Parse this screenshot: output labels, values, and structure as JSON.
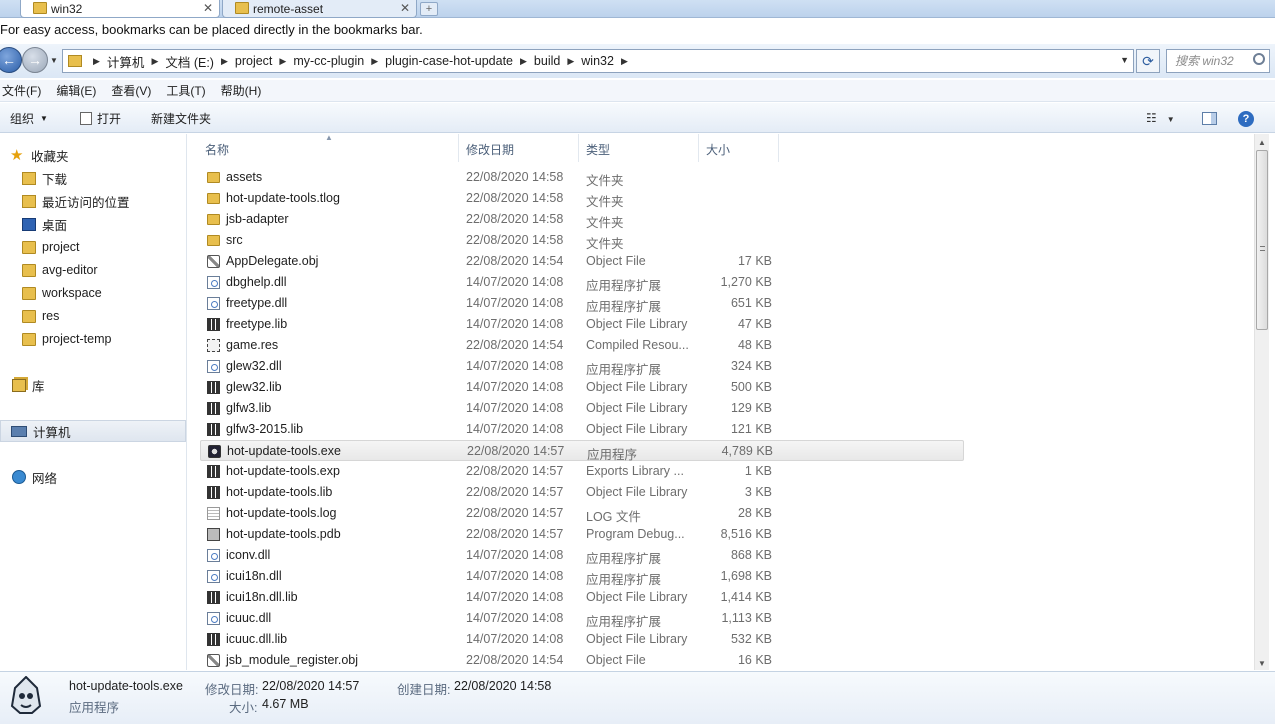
{
  "tabs": [
    {
      "label": "win32",
      "active": true
    },
    {
      "label": "remote-asset",
      "active": false
    }
  ],
  "bookmark_hint": "For easy access, bookmarks can be placed directly in the bookmarks bar.",
  "address": {
    "crumbs": [
      "计算机",
      "文档 (E:)",
      "project",
      "my-cc-plugin",
      "plugin-case-hot-update",
      "build",
      "win32"
    ],
    "search_placeholder": "搜索 win32"
  },
  "menu": [
    "文件(F)",
    "编辑(E)",
    "查看(V)",
    "工具(T)",
    "帮助(H)"
  ],
  "toolbar": {
    "organize": "组织",
    "open": "打开",
    "new_folder": "新建文件夹"
  },
  "nav": {
    "favorites": "收藏夹",
    "favorites_items": [
      "下载",
      "最近访问的位置",
      "桌面",
      "project",
      "avg-editor",
      "workspace",
      "res",
      "project-temp"
    ],
    "libraries": "库",
    "computer": "计算机",
    "network": "网络"
  },
  "columns": {
    "name": "名称",
    "date": "修改日期",
    "type": "类型",
    "size": "大小"
  },
  "files": [
    {
      "name": "assets",
      "date": "22/08/2020 14:58",
      "type": "文件夹",
      "size": "",
      "icon": "folder"
    },
    {
      "name": "hot-update-tools.tlog",
      "date": "22/08/2020 14:58",
      "type": "文件夹",
      "size": "",
      "icon": "folder"
    },
    {
      "name": "jsb-adapter",
      "date": "22/08/2020 14:58",
      "type": "文件夹",
      "size": "",
      "icon": "folder"
    },
    {
      "name": "src",
      "date": "22/08/2020 14:58",
      "type": "文件夹",
      "size": "",
      "icon": "folder"
    },
    {
      "name": "AppDelegate.obj",
      "date": "22/08/2020 14:54",
      "type": "Object File",
      "size": "17 KB",
      "icon": "obj"
    },
    {
      "name": "dbghelp.dll",
      "date": "14/07/2020 14:08",
      "type": "应用程序扩展",
      "size": "1,270 KB",
      "icon": "dll"
    },
    {
      "name": "freetype.dll",
      "date": "14/07/2020 14:08",
      "type": "应用程序扩展",
      "size": "651 KB",
      "icon": "dll"
    },
    {
      "name": "freetype.lib",
      "date": "14/07/2020 14:08",
      "type": "Object File Library",
      "size": "47 KB",
      "icon": "lib"
    },
    {
      "name": "game.res",
      "date": "22/08/2020 14:54",
      "type": "Compiled Resou...",
      "size": "48 KB",
      "icon": "res"
    },
    {
      "name": "glew32.dll",
      "date": "14/07/2020 14:08",
      "type": "应用程序扩展",
      "size": "324 KB",
      "icon": "dll"
    },
    {
      "name": "glew32.lib",
      "date": "14/07/2020 14:08",
      "type": "Object File Library",
      "size": "500 KB",
      "icon": "lib"
    },
    {
      "name": "glfw3.lib",
      "date": "14/07/2020 14:08",
      "type": "Object File Library",
      "size": "129 KB",
      "icon": "lib"
    },
    {
      "name": "glfw3-2015.lib",
      "date": "14/07/2020 14:08",
      "type": "Object File Library",
      "size": "121 KB",
      "icon": "lib"
    },
    {
      "name": "hot-update-tools.exe",
      "date": "22/08/2020 14:57",
      "type": "应用程序",
      "size": "4,789 KB",
      "icon": "exe",
      "selected": true
    },
    {
      "name": "hot-update-tools.exp",
      "date": "22/08/2020 14:57",
      "type": "Exports Library ...",
      "size": "1 KB",
      "icon": "lib"
    },
    {
      "name": "hot-update-tools.lib",
      "date": "22/08/2020 14:57",
      "type": "Object File Library",
      "size": "3 KB",
      "icon": "lib"
    },
    {
      "name": "hot-update-tools.log",
      "date": "22/08/2020 14:57",
      "type": "LOG 文件",
      "size": "28 KB",
      "icon": "log"
    },
    {
      "name": "hot-update-tools.pdb",
      "date": "22/08/2020 14:57",
      "type": "Program Debug...",
      "size": "8,516 KB",
      "icon": "pdb"
    },
    {
      "name": "iconv.dll",
      "date": "14/07/2020 14:08",
      "type": "应用程序扩展",
      "size": "868 KB",
      "icon": "dll"
    },
    {
      "name": "icui18n.dll",
      "date": "14/07/2020 14:08",
      "type": "应用程序扩展",
      "size": "1,698 KB",
      "icon": "dll"
    },
    {
      "name": "icui18n.dll.lib",
      "date": "14/07/2020 14:08",
      "type": "Object File Library",
      "size": "1,414 KB",
      "icon": "lib"
    },
    {
      "name": "icuuc.dll",
      "date": "14/07/2020 14:08",
      "type": "应用程序扩展",
      "size": "1,113 KB",
      "icon": "dll"
    },
    {
      "name": "icuuc.dll.lib",
      "date": "14/07/2020 14:08",
      "type": "Object File Library",
      "size": "532 KB",
      "icon": "lib"
    },
    {
      "name": "jsb_module_register.obj",
      "date": "22/08/2020 14:54",
      "type": "Object File",
      "size": "16 KB",
      "icon": "obj"
    }
  ],
  "details": {
    "filename": "hot-update-tools.exe",
    "filetype": "应用程序",
    "modified_label": "修改日期:",
    "modified_value": "22/08/2020 14:57",
    "created_label": "创建日期:",
    "created_value": "22/08/2020 14:58",
    "size_label": "大小:",
    "size_value": "4.67 MB"
  }
}
